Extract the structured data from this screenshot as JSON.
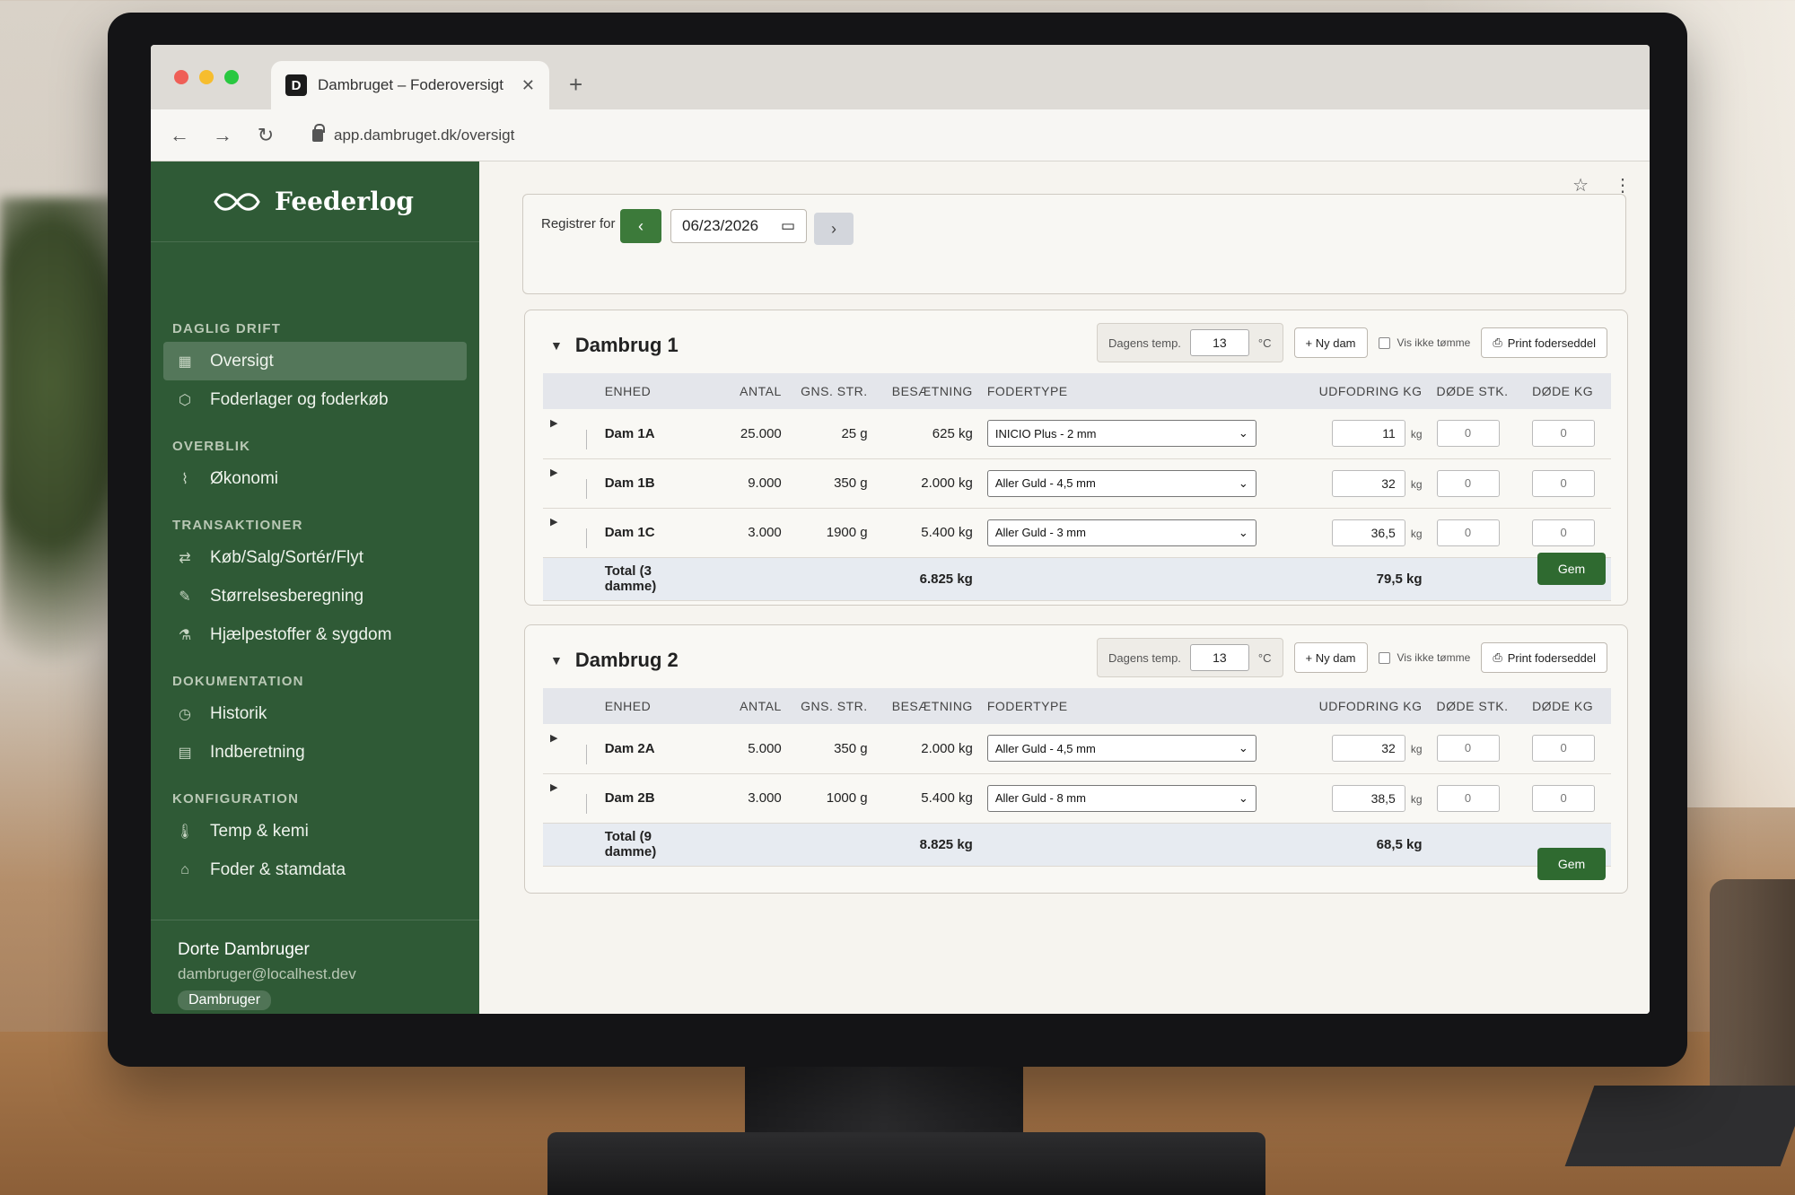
{
  "browser": {
    "tab_title": "Dambruget – Foderoversigt",
    "favicon_letter": "D",
    "url": "app.dambruget.dk/oversigt"
  },
  "brand": {
    "name": "Feederlog"
  },
  "sidebar": {
    "sections": [
      {
        "title": "DAGLIG DRIFT",
        "items": [
          {
            "label": "Oversigt",
            "icon": "grid-icon",
            "active": true
          },
          {
            "label": "Foderlager og foderkøb",
            "icon": "box-icon"
          }
        ]
      },
      {
        "title": "OVERBLIK",
        "items": [
          {
            "label": "Økonomi",
            "icon": "chart-icon"
          }
        ]
      },
      {
        "title": "TRANSAKTIONER",
        "items": [
          {
            "label": "Køb/Salg/Sortér/Flyt",
            "icon": "swap-icon"
          },
          {
            "label": "Størrelsesberegning",
            "icon": "ruler-icon"
          },
          {
            "label": "Hjælpestoffer & sygdom",
            "icon": "flask-icon"
          }
        ]
      },
      {
        "title": "DOKUMENTATION",
        "items": [
          {
            "label": "Historik",
            "icon": "clock-icon"
          },
          {
            "label": "Indberetning",
            "icon": "report-icon"
          }
        ]
      },
      {
        "title": "KONFIGURATION",
        "items": [
          {
            "label": "Temp & kemi",
            "icon": "thermometer-icon"
          },
          {
            "label": "Foder & stamdata",
            "icon": "home-icon"
          }
        ]
      }
    ],
    "user": {
      "name": "Dorte Dambruger",
      "email": "dambruger@localhest.dev",
      "role": "Dambruger"
    }
  },
  "datebar": {
    "label": "Registrer for",
    "date": "06/23/2026",
    "prev": "‹",
    "next": "›"
  },
  "columns": [
    "ENHED",
    "ANTAL",
    "GNS. STR.",
    "BESÆTNING",
    "FODERTYPE",
    "UDFODRING KG",
    "DØDE STK.",
    "DØDE KG"
  ],
  "farms": [
    {
      "title": "Dambrug 1",
      "temp_label": "Dagens temp.",
      "temp": "13",
      "temp_unit": "°C",
      "new_pond": "+ Ny dam",
      "empty_label": "Vis ikke tømme",
      "print": "Print foderseddel",
      "rows": [
        {
          "unit": "Dam 1A",
          "antal": "25.000",
          "str": "25 g",
          "besaetning": "625 kg",
          "feed": "INICIO Plus - 2 mm",
          "udfodring": "11",
          "dode_stk": "0",
          "dode_kg": "0"
        },
        {
          "unit": "Dam 1B",
          "antal": "9.000",
          "str": "350 g",
          "besaetning": "2.000 kg",
          "feed": "Aller Guld - 4,5 mm",
          "udfodring": "32",
          "dode_stk": "0",
          "dode_kg": "0"
        },
        {
          "unit": "Dam 1C",
          "antal": "3.000",
          "str": "1900 g",
          "besaetning": "5.400 kg",
          "feed": "Aller Guld - 3 mm",
          "udfodring": "36,5",
          "dode_stk": "0",
          "dode_kg": "0"
        }
      ],
      "total_label": "Total (3 damme)",
      "total_besaetning": "6.825 kg",
      "total_udfodring": "79,5 kg",
      "save": "Gem"
    },
    {
      "title": "Dambrug 2",
      "temp_label": "Dagens temp.",
      "temp": "13",
      "temp_unit": "°C",
      "new_pond": "+ Ny dam",
      "empty_label": "Vis ikke tømme",
      "print": "Print foderseddel",
      "rows": [
        {
          "unit": "Dam 2A",
          "antal": "5.000",
          "str": "350 g",
          "besaetning": "2.000 kg",
          "feed": "Aller Guld - 4,5 mm",
          "udfodring": "32",
          "dode_stk": "0",
          "dode_kg": "0"
        },
        {
          "unit": "Dam 2B",
          "antal": "3.000",
          "str": "1000 g",
          "besaetning": "5.400 kg",
          "feed": "Aller Guld - 8 mm",
          "udfodring": "38,5",
          "dode_stk": "0",
          "dode_kg": "0"
        }
      ],
      "total_label": "Total (9 damme)",
      "total_besaetning": "8.825 kg",
      "total_udfodring": "68,5 kg",
      "save": "Gem"
    }
  ],
  "units": {
    "kg": "kg"
  }
}
